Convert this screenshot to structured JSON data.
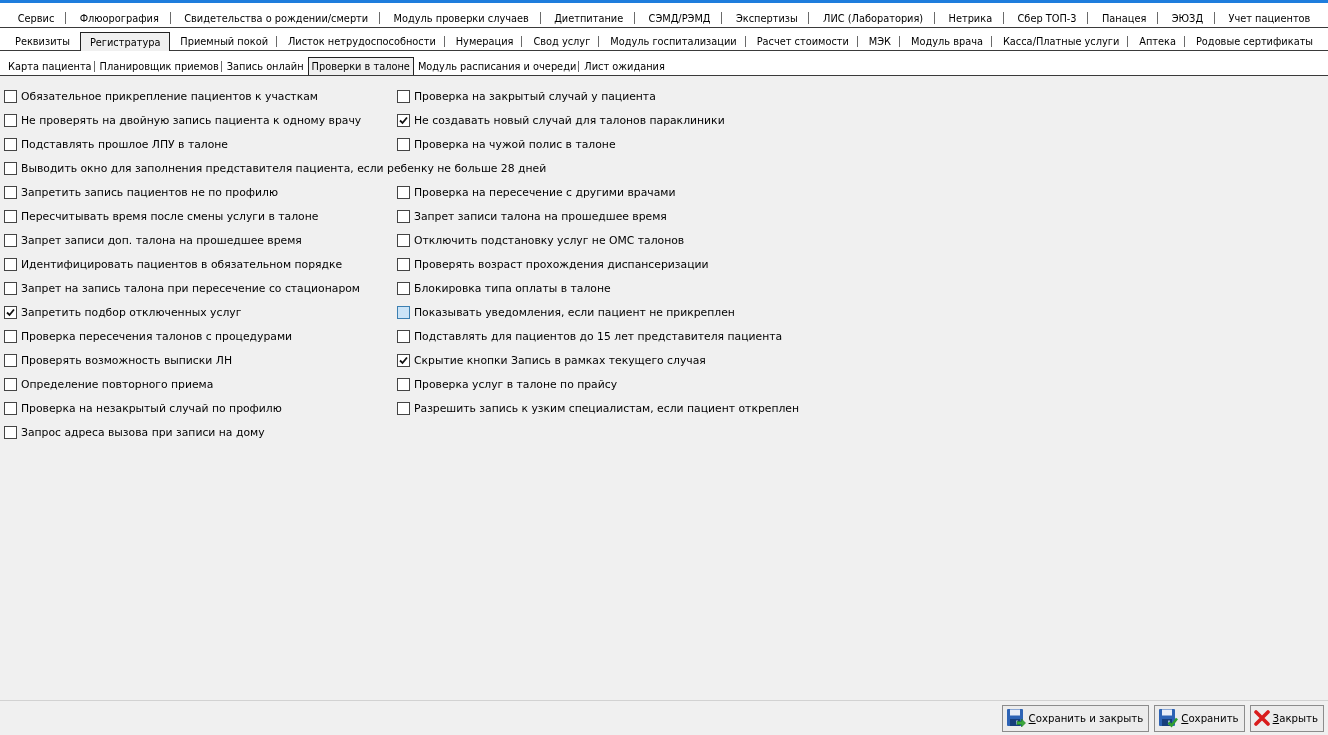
{
  "main_tabs": {
    "rows": [
      {
        "tabs": [
          {
            "label": "Сервис",
            "selected": false
          },
          {
            "label": "Флюорография",
            "selected": false
          },
          {
            "label": "Свидетельства о рождении/смерти",
            "selected": false
          },
          {
            "label": "Модуль проверки случаев",
            "selected": false
          },
          {
            "label": "Диетпитание",
            "selected": false
          },
          {
            "label": "СЭМД/РЭМД",
            "selected": false
          },
          {
            "label": "Экспертизы",
            "selected": false
          },
          {
            "label": "ЛИС (Лаборатория)",
            "selected": false
          },
          {
            "label": "Нетрика",
            "selected": false
          },
          {
            "label": "Сбер ТОП-3",
            "selected": false
          },
          {
            "label": "Панацея",
            "selected": false
          },
          {
            "label": "ЭЮЗД",
            "selected": false
          },
          {
            "label": "Учет пациентов",
            "selected": false
          }
        ]
      },
      {
        "tabs": [
          {
            "label": "Реквизиты",
            "selected": false
          },
          {
            "label": "Регистратура",
            "selected": true
          },
          {
            "label": "Приемный покой",
            "selected": false
          },
          {
            "label": "Листок нетрудоспособности",
            "selected": false
          },
          {
            "label": "Нумерация",
            "selected": false
          },
          {
            "label": "Свод услуг",
            "selected": false
          },
          {
            "label": "Модуль госпитализации",
            "selected": false
          },
          {
            "label": "Расчет стоимости",
            "selected": false
          },
          {
            "label": "МЭК",
            "selected": false
          },
          {
            "label": "Модуль врача",
            "selected": false
          },
          {
            "label": "Касса/Платные услуги",
            "selected": false
          },
          {
            "label": "Аптека",
            "selected": false
          },
          {
            "label": "Родовые сертификаты",
            "selected": false
          }
        ]
      }
    ]
  },
  "sub_tabs": [
    {
      "label": "Карта пациента",
      "selected": false
    },
    {
      "label": "Планировщик приемов",
      "selected": false
    },
    {
      "label": "Запись онлайн",
      "selected": false
    },
    {
      "label": "Проверки в талоне",
      "selected": true
    },
    {
      "label": "Модуль расписания и очереди",
      "selected": false
    },
    {
      "label": "Лист ожидания",
      "selected": false
    }
  ],
  "option_rows": [
    {
      "options": [
        {
          "label": "Обязательное прикрепление пациентов к участкам",
          "checked": false,
          "hovered": false
        },
        {
          "label": "Проверка на закрытый случай у пациента",
          "checked": false,
          "hovered": false
        }
      ]
    },
    {
      "options": [
        {
          "label": "Не проверять на двойную запись пациента к одному врачу",
          "checked": false,
          "hovered": false
        },
        {
          "label": "Не создавать новый случай для талонов параклиники",
          "checked": true,
          "hovered": false
        }
      ]
    },
    {
      "options": [
        {
          "label": "Подставлять прошлое ЛПУ в талоне",
          "checked": false,
          "hovered": false
        },
        {
          "label": "Проверка на чужой полис в талоне",
          "checked": false,
          "hovered": false
        }
      ]
    },
    {
      "options": [
        {
          "label": "Выводить окно для заполнения представителя пациента, если ребенку не больше 28 дней",
          "checked": false,
          "hovered": false
        }
      ]
    },
    {
      "options": [
        {
          "label": "Запретить запись пациентов не по профилю",
          "checked": false,
          "hovered": false
        },
        {
          "label": "Проверка на пересечение с другими врачами",
          "checked": false,
          "hovered": false
        }
      ]
    },
    {
      "options": [
        {
          "label": "Пересчитывать время после смены услуги в талоне",
          "checked": false,
          "hovered": false
        },
        {
          "label": "Запрет записи талона на прошедшее время",
          "checked": false,
          "hovered": false
        }
      ]
    },
    {
      "options": [
        {
          "label": "Запрет записи доп. талона на прошедшее время",
          "checked": false,
          "hovered": false
        },
        {
          "label": "Отключить подстановку услуг не ОМС талонов",
          "checked": false,
          "hovered": false
        }
      ]
    },
    {
      "options": [
        {
          "label": "Идентифицировать пациентов в обязательном порядке",
          "checked": false,
          "hovered": false
        },
        {
          "label": "Проверять возраст прохождения диспансеризации",
          "checked": false,
          "hovered": false
        }
      ]
    },
    {
      "options": [
        {
          "label": "Запрет на запись талона при пересечение со стационаром",
          "checked": false,
          "hovered": false
        },
        {
          "label": "Блокировка типа оплаты в талоне",
          "checked": false,
          "hovered": false
        }
      ]
    },
    {
      "options": [
        {
          "label": "Запретить подбор отключенных услуг",
          "checked": true,
          "hovered": false
        },
        {
          "label": "Показывать уведомления, если пациент не прикреплен",
          "checked": false,
          "hovered": true
        }
      ]
    },
    {
      "options": [
        {
          "label": "Проверка пересечения талонов с процедурами",
          "checked": false,
          "hovered": false
        },
        {
          "label": "Подставлять для пациентов до 15 лет представителя пациента",
          "checked": false,
          "hovered": false
        }
      ]
    },
    {
      "options": [
        {
          "label": "Проверять возможность выписки ЛН",
          "checked": false,
          "hovered": false
        },
        {
          "label": "Скрытие кнопки Запись в рамках текущего случая",
          "checked": true,
          "hovered": false
        }
      ]
    },
    {
      "options": [
        {
          "label": "Определение повторного приема",
          "checked": false,
          "hovered": false
        },
        {
          "label": "Проверка услуг в талоне по прайсу",
          "checked": false,
          "hovered": false
        }
      ]
    },
    {
      "options": [
        {
          "label": "Проверка на незакрытый случай по профилю",
          "checked": false,
          "hovered": false
        },
        {
          "label": "Разрешить запись к узким специалистам, если пациент откреплен",
          "checked": false,
          "hovered": false
        }
      ]
    },
    {
      "options": [
        {
          "label": "Запрос адреса вызова при записи на дому",
          "checked": false,
          "hovered": false
        }
      ]
    }
  ],
  "buttons": [
    {
      "label": "Сохранить и закрыть",
      "kind": "save_close"
    },
    {
      "label": "Сохранить",
      "kind": "save"
    },
    {
      "label": "Закрыть",
      "kind": "close"
    }
  ]
}
